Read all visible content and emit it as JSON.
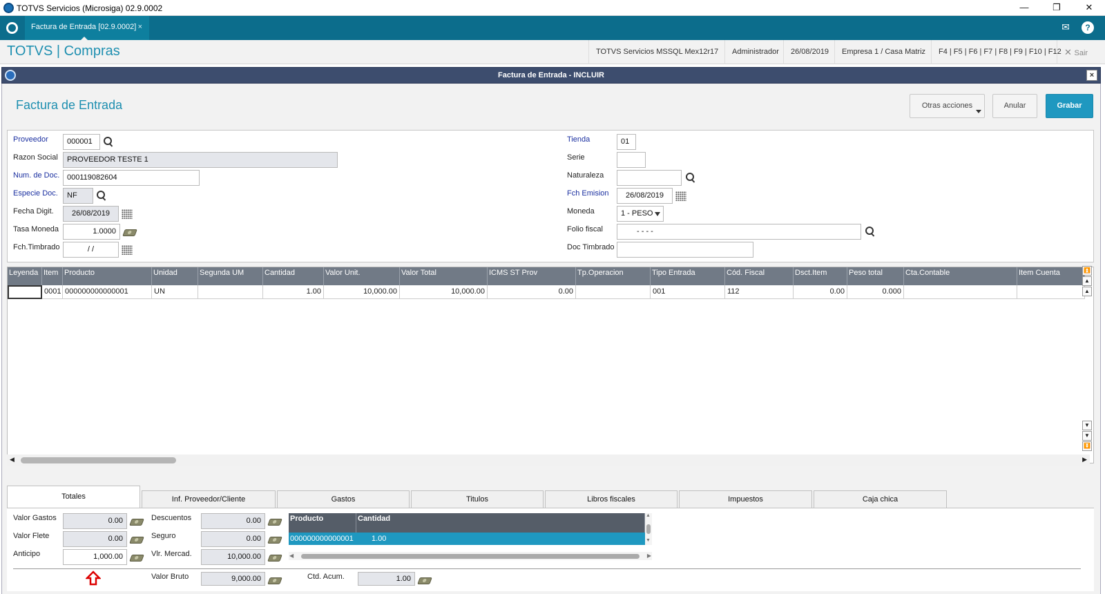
{
  "window": {
    "title": "TOTVS Servicios (Microsiga) 02.9.0002",
    "minimize": "—",
    "restore": "❐",
    "close": "✕"
  },
  "tabbar": {
    "tab_label": "Factura de Entrada [02.9.0002]",
    "tab_close": "×",
    "mail_icon": "✉",
    "help_icon": "?"
  },
  "header": {
    "brand": "TOTVS | Compras",
    "environment": "TOTVS Servicios MSSQL Mex12r17",
    "user": "Administrador",
    "date": "26/08/2019",
    "company": "Empresa 1 / Casa Matriz",
    "shortcuts": "F4 | F5 | F6 | F7 | F8 | F9 | F10 | F12",
    "exit_label": "Sair"
  },
  "dialog": {
    "title": "Factura de Entrada - INCLUIR",
    "close": "×",
    "page_title": "Factura de Entrada",
    "buttons": {
      "other_actions": "Otras acciones",
      "cancel": "Anular",
      "save": "Grabar"
    }
  },
  "form": {
    "proveedor": {
      "label": "Proveedor",
      "value": "000001"
    },
    "razon_social": {
      "label": "Razon Social",
      "value": "PROVEEDOR TESTE 1"
    },
    "num_doc": {
      "label": "Num. de Doc.",
      "value": "000119082604"
    },
    "especie_doc": {
      "label": "Especie Doc.",
      "value": "NF"
    },
    "fecha_digit": {
      "label": "Fecha Digit.",
      "value": "26/08/2019"
    },
    "tasa_moneda": {
      "label": "Tasa Moneda",
      "value": "1.0000"
    },
    "fch_timbrado": {
      "label": "Fch.Timbrado",
      "value": " /  / "
    },
    "tienda": {
      "label": "Tienda",
      "value": "01"
    },
    "serie": {
      "label": "Serie",
      "value": ""
    },
    "naturaleza": {
      "label": "Naturaleza",
      "value": ""
    },
    "fch_emision": {
      "label": "Fch Emision",
      "value": "26/08/2019"
    },
    "moneda": {
      "label": "Moneda",
      "value": "1 - PESO"
    },
    "folio_fiscal": {
      "label": "Folio fiscal",
      "value": "-    -    -    -"
    },
    "doc_timbrado": {
      "label": "Doc Timbrado",
      "value": ""
    }
  },
  "grid": {
    "columns": [
      "Leyenda",
      "Item",
      "Producto",
      "Unidad",
      "Segunda UM",
      "Cantidad",
      "Valor Unit.",
      "Valor Total",
      "ICMS ST Prov",
      "Tp.Operacion",
      "Tipo Entrada",
      "Cód. Fiscal",
      "Dsct.Item",
      "Peso total",
      "Cta.Contable",
      "Item Cuenta"
    ],
    "rows": [
      [
        "",
        "0001",
        "000000000000001",
        "UN",
        "",
        "1.00",
        "10,000.00",
        "10,000.00",
        "0.00",
        "",
        "001",
        "112",
        "0.00",
        "0.000",
        "",
        ""
      ]
    ]
  },
  "folders": {
    "tabs": [
      "Totales",
      "Inf. Proveedor/Cliente",
      "Gastos",
      "Titulos",
      "Libros fiscales",
      "Impuestos",
      "Caja chica"
    ],
    "active": "Totales"
  },
  "totales": {
    "valor_gastos": {
      "label": "Valor Gastos",
      "value": "0.00"
    },
    "valor_flete": {
      "label": "Valor Flete",
      "value": "0.00"
    },
    "anticipo": {
      "label": "Anticipo",
      "value": "1,000.00"
    },
    "descuentos": {
      "label": "Descuentos",
      "value": "0.00"
    },
    "seguro": {
      "label": "Seguro",
      "value": "0.00"
    },
    "vlr_mercad": {
      "label": "Vlr. Mercad.",
      "value": "10,000.00"
    },
    "valor_bruto": {
      "label": "Valor Bruto",
      "value": "9,000.00"
    },
    "ctd_acum": {
      "label": "Ctd. Acum.",
      "value": "1.00"
    },
    "mini_grid": {
      "columns": [
        "Producto",
        "Cantidad"
      ],
      "row": [
        "000000000000001",
        "1.00"
      ]
    }
  }
}
